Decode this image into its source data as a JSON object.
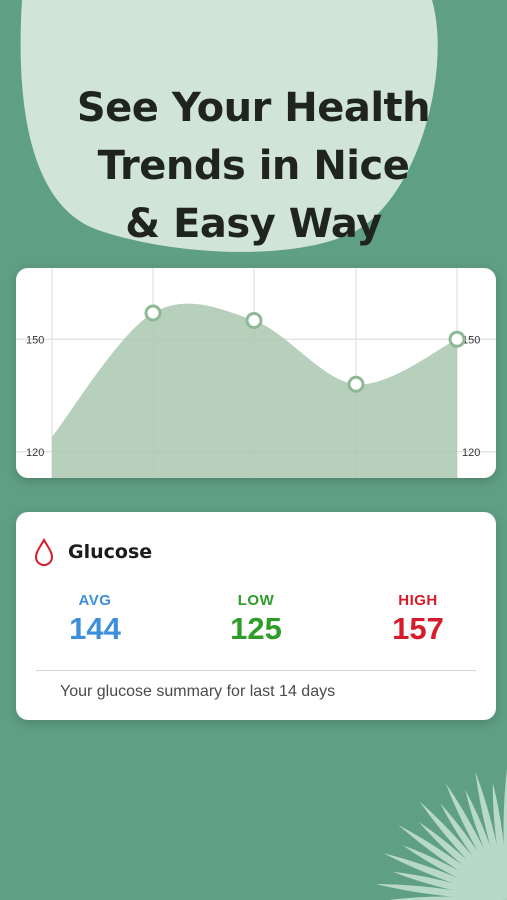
{
  "headline": {
    "line1": "See Your Health",
    "line2": "Trends in Nice",
    "line3": "& Easy Way"
  },
  "colors": {
    "background": "#5f9f83",
    "blob": "#d6e8dc",
    "area_fill": "#a9c8b0",
    "avg": "#3d8fdc",
    "low": "#2f9c2a",
    "high": "#d61c2a",
    "drop_icon": "#d61c2a"
  },
  "chart_data": {
    "type": "area",
    "y_ticks_left": [
      "150",
      "120"
    ],
    "y_ticks_right": [
      "150",
      "120"
    ],
    "tick_values": [
      150,
      120
    ],
    "ylim": [
      113,
      169
    ],
    "grid": true,
    "x": [
      0,
      1,
      2,
      3,
      4
    ],
    "values": [
      124,
      157,
      155,
      138,
      150
    ],
    "markers": [
      1,
      2,
      3,
      4
    ]
  },
  "glucose": {
    "icon": "drop-icon",
    "title": "Glucose",
    "avg_label": "AVG",
    "avg_value": "144",
    "low_label": "LOW",
    "low_value": "125",
    "high_label": "HIGH",
    "high_value": "157",
    "summary": "Your glucose summary for last 14 days"
  },
  "decoration": {
    "corner_icon": "palm-leaf-icon"
  }
}
